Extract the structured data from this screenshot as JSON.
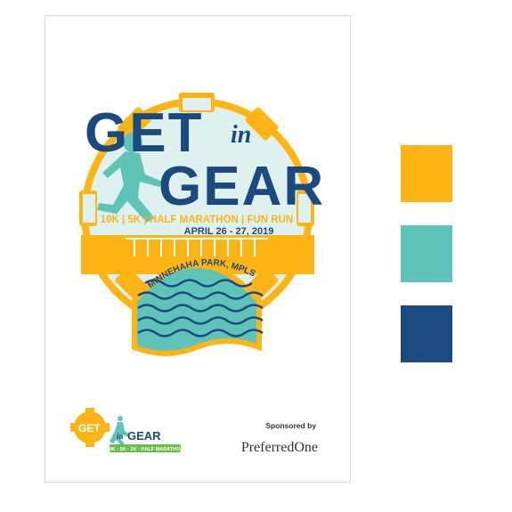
{
  "poster": {
    "title_line1": "GET",
    "title_in": "in",
    "title_line2": "GEAR",
    "events_line": "10K | 5K | HALF MARATHON | FUN RUN",
    "date_line": "APRIL 26 - 27, 2019",
    "location_line": "MINNEHAHA PARK, MPLS"
  },
  "footer": {
    "logo_get": "GET",
    "logo_in": "in",
    "logo_gear": "GEAR",
    "logo_tagline": "10K · 5K · 2K · HALF MARATHON",
    "sponsored_by": "Sponsored by",
    "sponsor_name": "PreferredOne"
  },
  "palette": {
    "colors": [
      "#FDB515",
      "#5EC4B9",
      "#1B4A80"
    ],
    "names": [
      "gold",
      "teal",
      "navy"
    ]
  }
}
